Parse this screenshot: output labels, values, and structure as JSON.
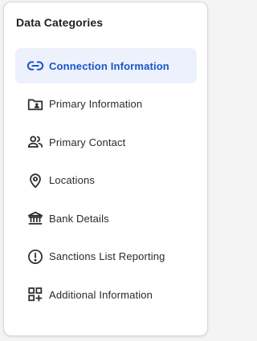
{
  "panel": {
    "title": "Data Categories"
  },
  "nav": {
    "items": [
      {
        "label": "Connection Information",
        "icon": "link-icon",
        "active": true
      },
      {
        "label": "Primary Information",
        "icon": "id-card-icon",
        "active": false
      },
      {
        "label": "Primary Contact",
        "icon": "people-icon",
        "active": false
      },
      {
        "label": "Locations",
        "icon": "location-pin-icon",
        "active": false
      },
      {
        "label": "Bank Details",
        "icon": "bank-icon",
        "active": false
      },
      {
        "label": "Sanctions List Reporting",
        "icon": "alert-circle-icon",
        "active": false
      },
      {
        "label": "Additional Information",
        "icon": "grid-add-icon",
        "active": false
      }
    ]
  },
  "colors": {
    "accent": "#1a56c7",
    "active_background": "#edf1fc",
    "text": "#2a2a2a"
  }
}
